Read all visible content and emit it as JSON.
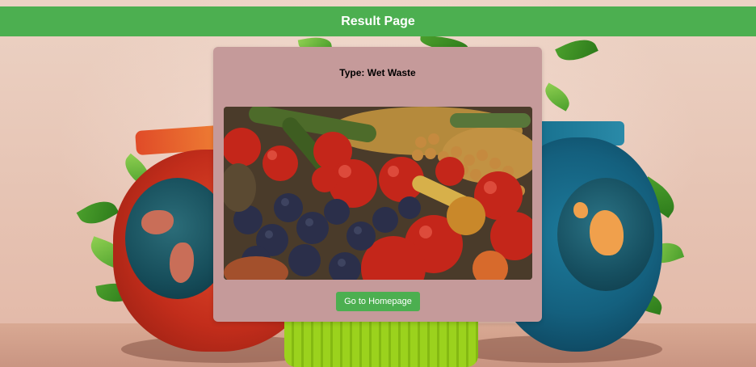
{
  "header": {
    "title": "Result Page",
    "background_color": "#4caf50"
  },
  "result_card": {
    "type_label": "Type:",
    "type_value": "Wet Waste",
    "background_color": "#c59a9a",
    "image": {
      "description_icon": "waste-photo"
    },
    "home_button_label": "Go to Homepage",
    "home_button_color": "#4caf50"
  }
}
